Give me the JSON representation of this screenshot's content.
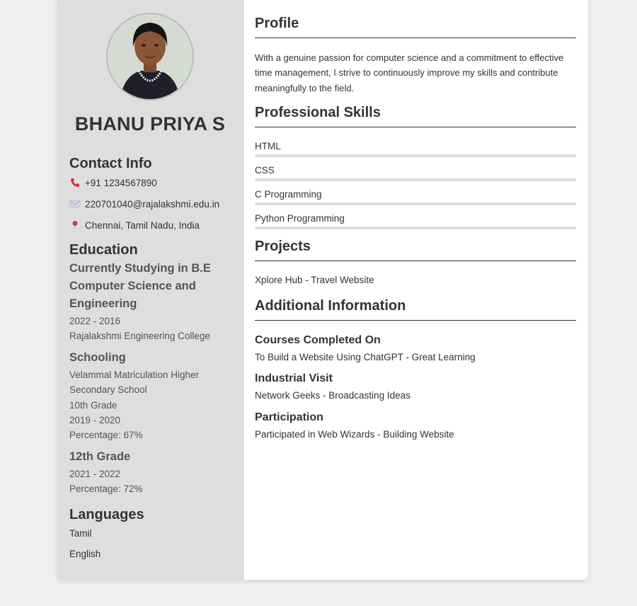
{
  "sidebar": {
    "name": "BHANU PRIYA S",
    "contact": {
      "heading": "Contact Info",
      "phone": "+91 1234567890",
      "email": "220701040@rajalakshmi.edu.in",
      "location": "Chennai, Tamil Nadu, India"
    },
    "education": {
      "heading": "Education",
      "degree_line1": "Currently Studying in B.E",
      "degree_line2": "Computer Science and",
      "degree_line3": "Engineering",
      "years": "2022 - 2016",
      "college": "Rajalakshmi Engineering College"
    },
    "schooling": {
      "heading": "Schooling",
      "school_line1": "Velammal Matriculation Higher",
      "school_line2": "Secondary School",
      "grade10": "10th Grade",
      "grade10_years": "2019 - 2020",
      "grade10_percentage": "Percentage: 67%",
      "grade12_heading": "12th Grade",
      "grade12_years": "2021 - 2022",
      "grade12_percentage": "Percentage: 72%"
    },
    "languages": {
      "heading": "Languages",
      "items": [
        "Tamil",
        "English"
      ]
    }
  },
  "main": {
    "profile": {
      "heading": "Profile",
      "line1": "With a genuine passion for computer science and a commitment to effective",
      "line2": "time management, I strive to continuously improve my skills and contribute",
      "line3": "meaningfully to the field."
    },
    "skills": {
      "heading": "Professional Skills",
      "items": [
        "HTML",
        "CSS",
        "C Programming",
        "Python Programming"
      ]
    },
    "projects": {
      "heading": "Projects",
      "items": [
        "Xplore Hub - Travel Website"
      ]
    },
    "additional": {
      "heading": "Additional Information",
      "courses_heading": "Courses Completed On",
      "courses_value": "To Build a Website Using ChatGPT - Great Learning",
      "visit_heading": "Industrial Visit",
      "visit_value": "Network Geeks - Broadcasting Ideas",
      "participation_heading": "Participation",
      "participation_value": "Participated in Web Wizards - Building Website"
    }
  },
  "colors": {
    "sidebar_bg": "#dedede",
    "phone_icon": "#e0283c",
    "email_icon": "#c9c9d9",
    "location_icon": "#e0288c",
    "skill_bar": "#dddddd"
  }
}
